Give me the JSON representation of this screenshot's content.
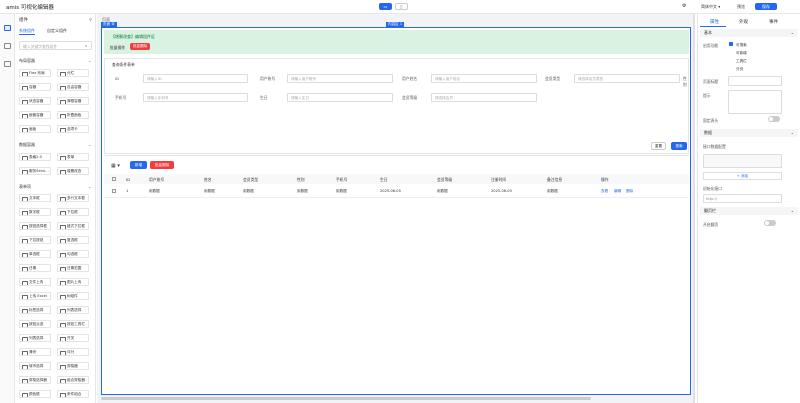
{
  "app": {
    "title": "amis 可视化编辑器"
  },
  "toolbar": {
    "lang": "简体中文",
    "preview": "预览",
    "save": "保存"
  },
  "left": {
    "title": "组件",
    "tabs": [
      "系统组件",
      "自定义组件"
    ],
    "search_placeholder": "输入关键字查找组件",
    "groups": [
      {
        "name": "布局容器",
        "items": [
          "Flex 布局",
          "分栏",
          "容器",
          "自由容器",
          "状态容器",
          "弹框容器",
          "嵌套容器",
          "折叠面板",
          "面板",
          "选项卡"
        ]
      },
      {
        "name": "数据容器",
        "items": [
          "表格2.0",
          "表单",
          "服务Servi...",
          "增删改查"
        ]
      },
      {
        "name": "表单项",
        "items": [
          "文本框",
          "多行文本框",
          "数字框",
          "下拉框",
          "按钮选择框",
          "链式下拉框",
          "下拉按钮",
          "复选框",
          "单选框",
          "勾选框",
          "日期",
          "日期范围",
          "文件上传",
          "图片上传",
          "上传 Excel",
          "树组件",
          "标签选择",
          "列表选择",
          "按钮点选",
          "按钮工具栏",
          "列表选择",
          "开关",
          "滑块",
          "评分",
          "城市选择",
          "穿梭器",
          "穿梭选择器",
          "组合穿梭器",
          "颜色框",
          "条件组合"
        ]
      }
    ]
  },
  "canvas": {
    "breadcrumb": "页面",
    "sel_label": "页面",
    "sel_label2": "内容区 1",
    "notice_title": "【增删改查】编辑组件区",
    "notice_left": "批量操作",
    "notice_btn": "批量删除",
    "filter_title": "查询条件表单",
    "filter_fields": [
      {
        "label": "ID",
        "placeholder": "请输入ID"
      },
      {
        "label": "用户账号",
        "placeholder": "请输入用户账号"
      },
      {
        "label": "用户姓名",
        "placeholder": "请输入用户姓名"
      },
      {
        "label": "会员类型",
        "placeholder": "请选择会员类型"
      },
      {
        "label": "手机号",
        "placeholder": "请输入手机号"
      },
      {
        "label": "生日",
        "placeholder": "请输入生日"
      },
      {
        "label": "会员等级",
        "placeholder": "请选择会员"
      }
    ],
    "filter_extra": "性别",
    "reset": "重置",
    "search": "搜索",
    "add": "新增",
    "batch_delete": "批量删除",
    "columns": [
      "ID",
      "用户账号",
      "姓名",
      "会员类型",
      "性别",
      "手机号",
      "生日",
      "会员等级",
      "注册时间",
      "备注信息",
      "操作"
    ],
    "row": [
      "1",
      "用数据",
      "用数据",
      "用数据",
      "用数据",
      "用数据",
      "2025-06-05",
      "用数据",
      "2025-06-05",
      "用数据"
    ],
    "ops": [
      "查看",
      "编辑",
      "删除"
    ]
  },
  "right": {
    "tabs": [
      "属性",
      "外观",
      "事件"
    ],
    "sec_basic": "基本",
    "label_fields": "启用功能",
    "fields": [
      "可搜索",
      "可新增",
      "工具栏",
      "分页"
    ],
    "label_title": "页面标题",
    "label_remark": "提示",
    "label_toggle": "固定表头",
    "sec_data": "数据",
    "label_api": "接口数据配置",
    "add_field": "+ 添加",
    "label_init": "初始化接口",
    "init_value": "http://",
    "sec_toolbar": "翻页栏",
    "label_page": "开启翻页"
  }
}
